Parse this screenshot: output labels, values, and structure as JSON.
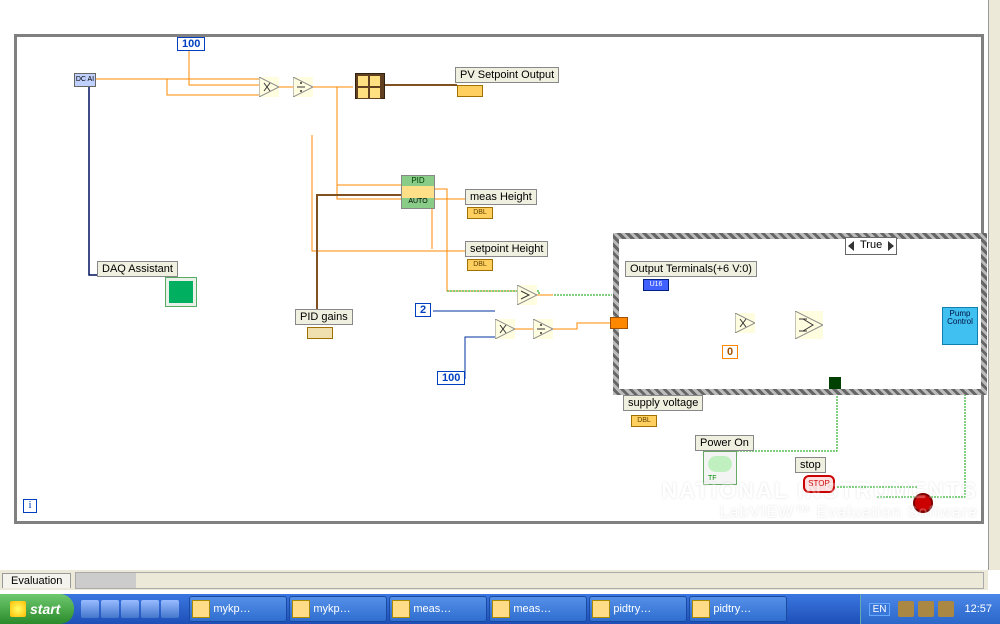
{
  "diagram": {
    "constants": {
      "c100a": "100",
      "c2": "2",
      "c100b": "100",
      "c0": "0"
    },
    "nodes": {
      "daq_assistant": "DAQ Assistant",
      "pid_gains": "PID gains",
      "pv_setpoint_output": "PV Setpoint Output",
      "meas_height": "meas Height",
      "setpoint_height": "setpoint Height",
      "output_terminals": "Output Terminals(+6 V:0)",
      "supply_voltage": "supply voltage",
      "power_on": "Power On",
      "stop": "stop",
      "pump_control": "Pump Control"
    },
    "terms": {
      "dbl": "DBL",
      "u16": "U16",
      "tf": "TF",
      "auto": "AUTO",
      "pid": "PID"
    },
    "case_selector": "True",
    "daq_data_label": "DC AI",
    "iter_label": "i"
  },
  "eval_tab": "Evaluation",
  "watermark": {
    "line1": "NATIONAL INSTRUMENTS",
    "line2": "LabVIEW™ Evaluation Software"
  },
  "taskbar": {
    "start": "start",
    "buttons": [
      "mykp…",
      "mykp…",
      "meas…",
      "meas…",
      "pidtry…",
      "pidtry…"
    ],
    "lang": "EN",
    "clock": "12:57"
  }
}
